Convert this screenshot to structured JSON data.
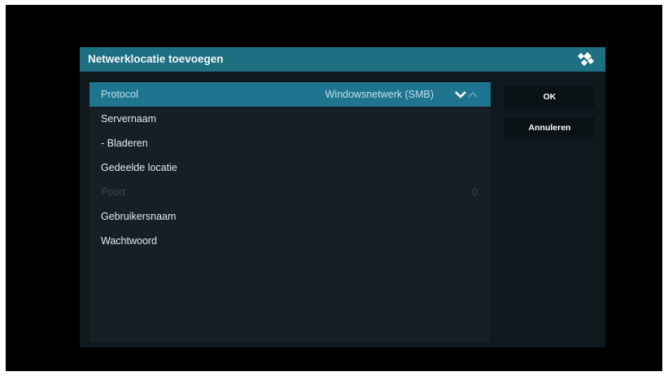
{
  "dialog": {
    "title": "Netwerklocatie toevoegen",
    "logo_icon": "kodi-logo-icon"
  },
  "settings": [
    {
      "label": "Protocol",
      "value": "Windowsnetwerk (SMB)",
      "selected": true
    },
    {
      "label": "Servernaam",
      "value": ""
    },
    {
      "label": "- Bladeren",
      "value": ""
    },
    {
      "label": "Gedeelde locatie",
      "value": ""
    },
    {
      "label": "Poort",
      "value": "0",
      "disabled": true
    },
    {
      "label": "Gebruikersnaam",
      "value": ""
    },
    {
      "label": "Wachtwoord",
      "value": ""
    }
  ],
  "buttons": {
    "ok": "OK",
    "cancel": "Annuleren"
  },
  "icons": {
    "spin_down": "chevron-down-icon",
    "spin_up": "chevron-up-icon"
  },
  "colors": {
    "accent": "#1f7490",
    "titlebar": "#1e6f82",
    "panel": "#161f25",
    "dialog": "#0f181d"
  }
}
